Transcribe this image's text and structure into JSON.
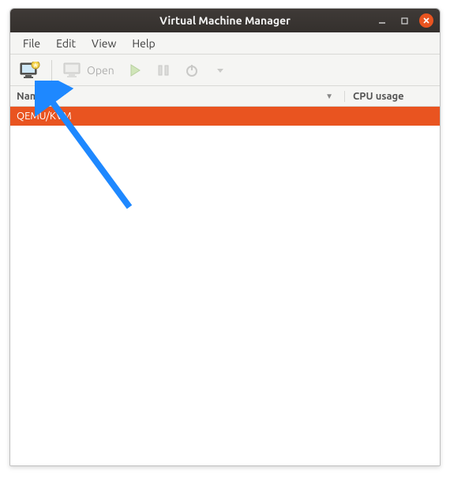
{
  "titlebar": {
    "title": "Virtual Machine Manager"
  },
  "menubar": {
    "items": [
      {
        "label": "File"
      },
      {
        "label": "Edit"
      },
      {
        "label": "View"
      },
      {
        "label": "Help"
      }
    ]
  },
  "toolbar": {
    "open_label": "Open"
  },
  "columns": {
    "name": "Name",
    "cpu": "CPU usage"
  },
  "rows": [
    {
      "label": "QEMU/KVM"
    }
  ],
  "colors": {
    "accent": "#e95420"
  }
}
